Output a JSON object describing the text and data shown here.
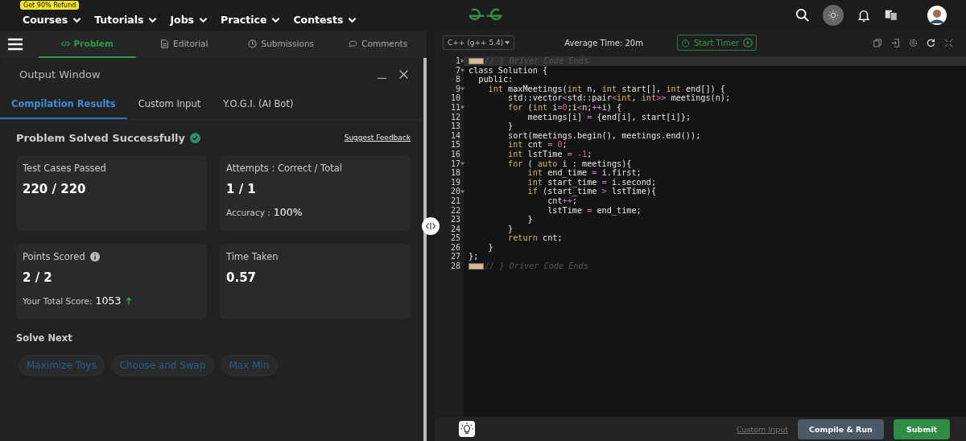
{
  "topnav": {
    "badge": "Get 90% Refund",
    "menus": [
      {
        "label": "Courses"
      },
      {
        "label": "Tutorials"
      },
      {
        "label": "Jobs"
      },
      {
        "label": "Practice"
      },
      {
        "label": "Contests"
      }
    ],
    "theme_toggle": {
      "on": true
    }
  },
  "problem_tabs": [
    {
      "label": "Problem",
      "selected": true
    },
    {
      "label": "Editorial",
      "selected": false
    },
    {
      "label": "Submissions",
      "selected": false
    },
    {
      "label": "Comments",
      "selected": false
    }
  ],
  "output_window": {
    "title": "Output Window",
    "tabs": [
      {
        "label": "Compilation Results",
        "selected": true
      },
      {
        "label": "Custom Input",
        "selected": false
      },
      {
        "label": "Y.O.G.I. (AI Bot)",
        "selected": false
      }
    ],
    "status": "Problem Solved Successfully",
    "feedback_link": "Suggest Feedback",
    "cards": [
      {
        "kind": "plain",
        "label": "Test Cases Passed",
        "value": "220 / 220"
      },
      {
        "kind": "ratio",
        "label": "Attempts : Correct / Total",
        "value": "1 / 1",
        "sub_label": "Accuracy :",
        "sub_value": "100%"
      },
      {
        "kind": "score",
        "label": "Points Scored",
        "value": "2 / 2",
        "sub_label": "Your Total Score:",
        "sub_value": "1053"
      },
      {
        "kind": "plain",
        "label": "Time Taken",
        "value": "0.57"
      }
    ],
    "solve_next_title": "Solve Next",
    "solve_next": [
      "Maximize Toys",
      "Choose and Swap",
      "Max Min"
    ]
  },
  "editor": {
    "language": "C++ (g++ 5.4)",
    "average_time": "Average Time: 20m",
    "timer_button": "Start Timer",
    "lines": [
      {
        "num": "1",
        "kind": "folded",
        "active": true,
        "tokens": [
          {
            "text": "// } Driver Code Ends",
            "kind": "comment"
          }
        ]
      },
      {
        "num": "7",
        "kind": "foldable",
        "active": false,
        "tokens": [
          {
            "text": "class Solution {",
            "kind": "plain"
          }
        ]
      },
      {
        "num": "8",
        "kind": "plain",
        "active": false,
        "tokens": [
          {
            "text": "  public:",
            "kind": "plain"
          }
        ]
      },
      {
        "num": "9",
        "kind": "foldable",
        "active": false,
        "tokens": [
          {
            "text": "    int",
            "kind": "keyword"
          },
          {
            "text": " maxMeetings(",
            "kind": "plain"
          },
          {
            "text": "int",
            "kind": "keyword"
          },
          {
            "text": " n, ",
            "kind": "plain"
          },
          {
            "text": "int",
            "kind": "keyword"
          },
          {
            "text": " start[], ",
            "kind": "plain"
          },
          {
            "text": "int",
            "kind": "keyword"
          },
          {
            "text": " end[]) {",
            "kind": "plain"
          }
        ]
      },
      {
        "num": "10",
        "kind": "plain",
        "active": false,
        "tokens": [
          {
            "text": "        std::vector",
            "kind": "plain"
          },
          {
            "text": "<",
            "kind": "operator"
          },
          {
            "text": "std::pair",
            "kind": "plain"
          },
          {
            "text": "<",
            "kind": "operator"
          },
          {
            "text": "int",
            "kind": "keyword"
          },
          {
            "text": ", ",
            "kind": "plain"
          },
          {
            "text": "int",
            "kind": "keyword"
          },
          {
            "text": ">>",
            "kind": "operator"
          },
          {
            "text": " meetings(n);",
            "kind": "plain"
          }
        ]
      },
      {
        "num": "11",
        "kind": "foldable",
        "active": false,
        "tokens": [
          {
            "text": "        for",
            "kind": "keyword"
          },
          {
            "text": " (",
            "kind": "plain"
          },
          {
            "text": "int",
            "kind": "keyword"
          },
          {
            "text": " i",
            "kind": "plain"
          },
          {
            "text": "=",
            "kind": "operator"
          },
          {
            "text": "0",
            "kind": "number"
          },
          {
            "text": ";i",
            "kind": "plain"
          },
          {
            "text": "<",
            "kind": "operator"
          },
          {
            "text": "n;",
            "kind": "plain"
          },
          {
            "text": "++",
            "kind": "operator"
          },
          {
            "text": "i) {",
            "kind": "plain"
          }
        ]
      },
      {
        "num": "12",
        "kind": "plain",
        "active": false,
        "tokens": [
          {
            "text": "            meetings[i] ",
            "kind": "plain"
          },
          {
            "text": "=",
            "kind": "operator"
          },
          {
            "text": " {end[i], start[i]};",
            "kind": "plain"
          }
        ]
      },
      {
        "num": "13",
        "kind": "plain",
        "active": false,
        "tokens": [
          {
            "text": "        }",
            "kind": "plain"
          }
        ]
      },
      {
        "num": "14",
        "kind": "plain",
        "active": false,
        "tokens": [
          {
            "text": "        sort(meetings.begin(), meetings.end());",
            "kind": "plain"
          }
        ]
      },
      {
        "num": "15",
        "kind": "plain",
        "active": false,
        "tokens": [
          {
            "text": "        int",
            "kind": "keyword"
          },
          {
            "text": " cnt ",
            "kind": "plain"
          },
          {
            "text": "=",
            "kind": "operator"
          },
          {
            "text": " 0",
            "kind": "number"
          },
          {
            "text": ";",
            "kind": "plain"
          }
        ]
      },
      {
        "num": "16",
        "kind": "plain",
        "active": false,
        "tokens": [
          {
            "text": "        int",
            "kind": "keyword"
          },
          {
            "text": " lstTime ",
            "kind": "plain"
          },
          {
            "text": "=",
            "kind": "operator"
          },
          {
            "text": " -1",
            "kind": "number"
          },
          {
            "text": ";",
            "kind": "plain"
          }
        ]
      },
      {
        "num": "17",
        "kind": "foldable",
        "active": false,
        "tokens": [
          {
            "text": "        for",
            "kind": "keyword"
          },
          {
            "text": " ( ",
            "kind": "plain"
          },
          {
            "text": "auto",
            "kind": "keyword"
          },
          {
            "text": " i : meetings){",
            "kind": "plain"
          }
        ]
      },
      {
        "num": "18",
        "kind": "plain",
        "active": false,
        "tokens": [
          {
            "text": "            int",
            "kind": "keyword"
          },
          {
            "text": " end_time ",
            "kind": "plain"
          },
          {
            "text": "=",
            "kind": "operator"
          },
          {
            "text": " i.first;",
            "kind": "plain"
          }
        ]
      },
      {
        "num": "19",
        "kind": "plain",
        "active": false,
        "tokens": [
          {
            "text": "            int",
            "kind": "keyword"
          },
          {
            "text": " start_time ",
            "kind": "plain"
          },
          {
            "text": "=",
            "kind": "operator"
          },
          {
            "text": " i.second;",
            "kind": "plain"
          }
        ]
      },
      {
        "num": "20",
        "kind": "foldable",
        "active": false,
        "tokens": [
          {
            "text": "            if",
            "kind": "keyword"
          },
          {
            "text": " (start_time ",
            "kind": "plain"
          },
          {
            "text": ">",
            "kind": "operator"
          },
          {
            "text": " lstTime){",
            "kind": "plain"
          }
        ]
      },
      {
        "num": "21",
        "kind": "plain",
        "active": false,
        "tokens": [
          {
            "text": "                cnt",
            "kind": "plain"
          },
          {
            "text": "++",
            "kind": "operator"
          },
          {
            "text": ";",
            "kind": "plain"
          }
        ]
      },
      {
        "num": "22",
        "kind": "plain",
        "active": false,
        "tokens": [
          {
            "text": "                lstTime ",
            "kind": "plain"
          },
          {
            "text": "=",
            "kind": "operator"
          },
          {
            "text": " end_time;",
            "kind": "plain"
          }
        ]
      },
      {
        "num": "23",
        "kind": "plain",
        "active": false,
        "tokens": [
          {
            "text": "            }",
            "kind": "plain"
          }
        ]
      },
      {
        "num": "24",
        "kind": "plain",
        "active": false,
        "tokens": [
          {
            "text": "        }",
            "kind": "plain"
          }
        ]
      },
      {
        "num": "25",
        "kind": "plain",
        "active": false,
        "tokens": [
          {
            "text": "        return",
            "kind": "keyword"
          },
          {
            "text": " cnt;",
            "kind": "plain"
          }
        ]
      },
      {
        "num": "26",
        "kind": "plain",
        "active": false,
        "tokens": [
          {
            "text": "    }",
            "kind": "plain"
          }
        ]
      },
      {
        "num": "27",
        "kind": "plain",
        "active": false,
        "tokens": [
          {
            "text": "};",
            "kind": "plain"
          }
        ]
      },
      {
        "num": "28",
        "kind": "collapsed",
        "active": false,
        "tokens": [
          {
            "text": "// } Driver Code Ends",
            "kind": "comment"
          }
        ]
      }
    ],
    "custom_input_link": "Custom Input",
    "compile_button": "Compile & Run",
    "submit_button": "Submit"
  }
}
